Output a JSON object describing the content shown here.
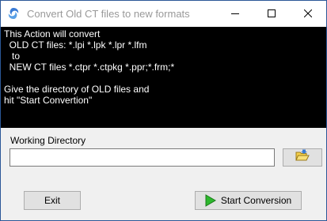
{
  "window": {
    "title": "Convert Old CT files to new formats"
  },
  "icons": {
    "app": "app-swirl-icon",
    "minimize": "minimize-icon",
    "maximize": "maximize-icon",
    "close": "close-icon",
    "browse": "folder-browse-icon",
    "convert": "play-icon"
  },
  "colors": {
    "console_bg": "#000000",
    "console_text": "#ffffff",
    "play_green": "#2db82d",
    "folder_yellow": "#f5d04a"
  },
  "console": {
    "lines": [
      "This Action will convert",
      "  OLD CT files: *.lpi *.lpk *.lpr *.lfm",
      "   to",
      "  NEW CT files *.ctpr *.ctpkg *.ppr;*.frm;*",
      "Give the directory of OLD files and",
      "hit \"Start Convertion\""
    ]
  },
  "working_directory": {
    "label": "Working Directory",
    "value": ""
  },
  "buttons": {
    "exit": "Exit",
    "start_conversion": "Start Conversion"
  }
}
